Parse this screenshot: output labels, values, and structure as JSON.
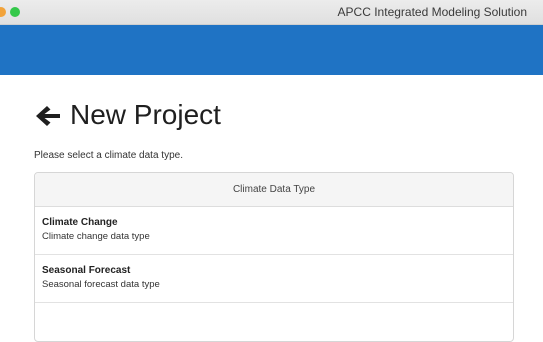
{
  "window": {
    "title": "APCC Integrated Modeling Solution"
  },
  "page": {
    "title": "New Project",
    "instructions": "Please select a climate data type."
  },
  "panel": {
    "header": "Climate Data Type",
    "options": [
      {
        "title": "Climate Change",
        "description": "Climate change data type"
      },
      {
        "title": "Seasonal Forecast",
        "description": "Seasonal forecast data type"
      }
    ]
  },
  "colors": {
    "appbar": "#1f73c4",
    "panel_header_bg": "#f5f5f5",
    "traffic_close": "#f2a33a",
    "traffic_zoom": "#34c84a"
  },
  "icons": {
    "back": "arrow-left-icon"
  }
}
